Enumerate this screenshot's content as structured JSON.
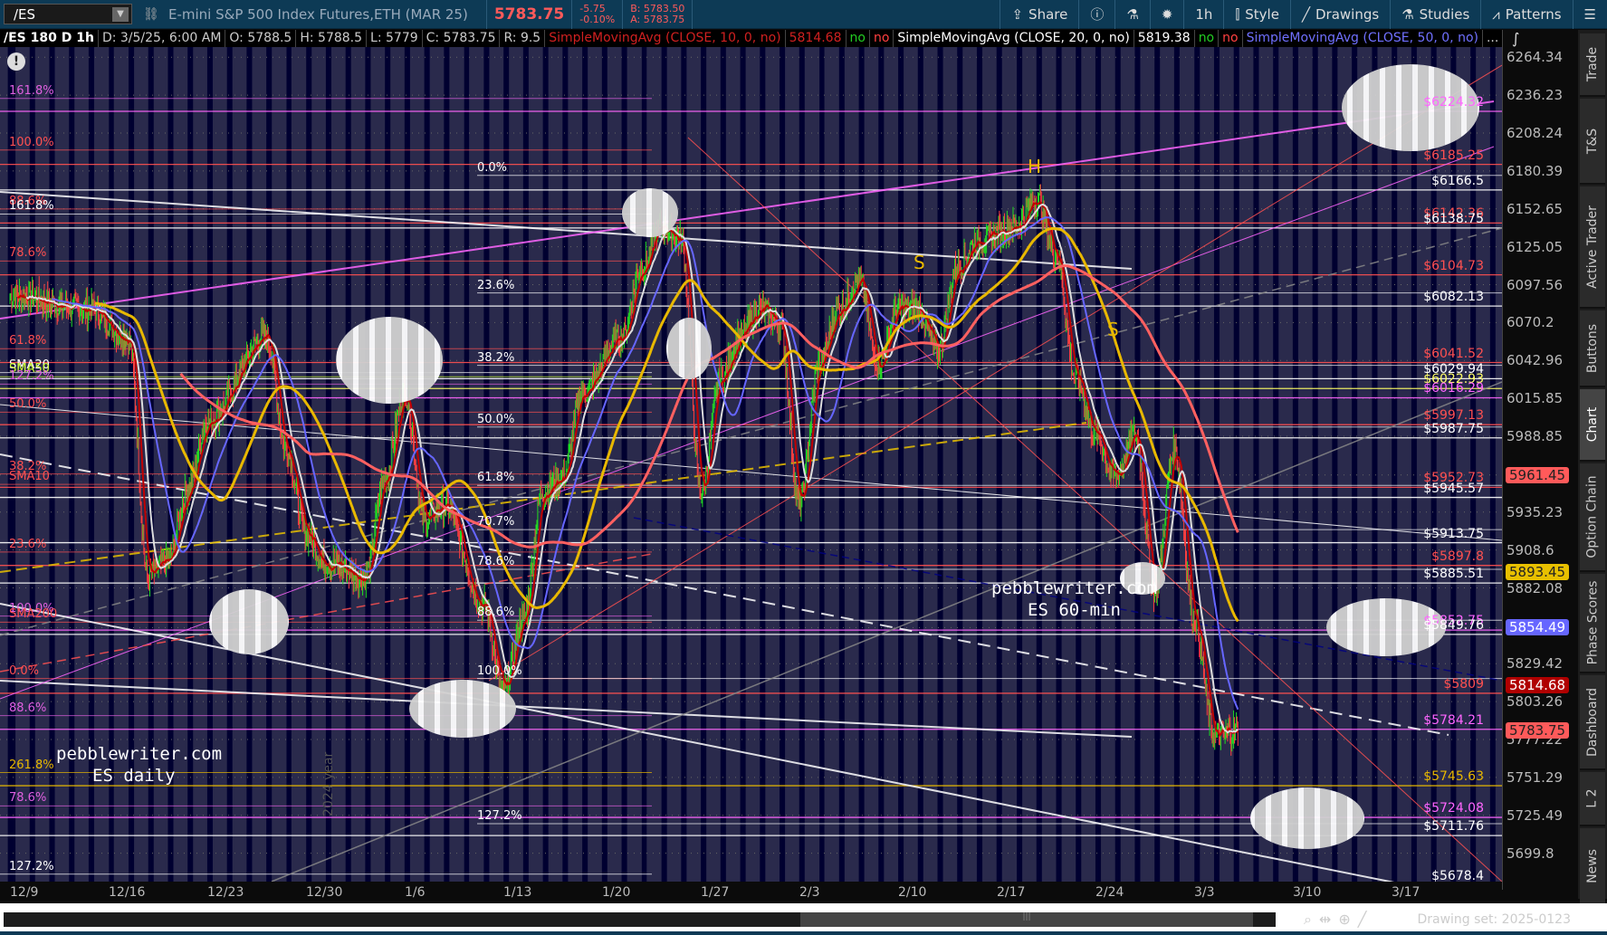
{
  "toolbar": {
    "symbol": "/ES",
    "description": "E-mini S&P 500 Index Futures,ETH (MAR 25)",
    "last": "5783.75",
    "change": "-5.75",
    "change_pct": "-0.10%",
    "bid": "B: 5783.50",
    "ask": "A: 5783.75",
    "share": "Share",
    "timeframe": "1h",
    "style": "Style",
    "drawings": "Drawings",
    "studies": "Studies",
    "patterns": "Patterns"
  },
  "infobar": {
    "symbol": "/ES 180 D 1h",
    "date": "D: 3/5/25, 6:00 AM",
    "open": "O: 5788.5",
    "high": "H: 5788.5",
    "low": "L: 5779",
    "close": "C: 5783.75",
    "range": "R: 9.5",
    "sma10": "SimpleMovingAvg (CLOSE, 10, 0, no)",
    "sma10_val": "5814.68",
    "no1": "no",
    "no2": "no",
    "sma20": "SimpleMovingAvg (CLOSE, 20, 0, no)",
    "sma20_val": "5819.38",
    "no3": "no",
    "no4": "no",
    "sma50": "SimpleMovingAvg (CLOSE, 50, 0, no)",
    "more": "..."
  },
  "price_axis": {
    "ticks": [
      "6264.34",
      "6236.23",
      "6208.24",
      "6180.39",
      "6152.65",
      "6125.05",
      "6097.56",
      "6070.2",
      "6042.96",
      "6015.85",
      "5988.85",
      "5961.45",
      "5935.23",
      "5908.6",
      "5882.08",
      "5854.49",
      "5829.42",
      "5803.26",
      "5777.22",
      "5751.29",
      "5725.49",
      "5699.8"
    ],
    "tags": [
      {
        "value": "5961.45",
        "bg": "#ff5a5a",
        "fg": "#222"
      },
      {
        "value": "5893.45",
        "bg": "#e8c000",
        "fg": "#222"
      },
      {
        "value": "5854.49",
        "bg": "#6666ff",
        "fg": "#fff"
      },
      {
        "value": "5814.68",
        "bg": "#b00000",
        "fg": "#fff"
      },
      {
        "value": "5783.75",
        "bg": "#ff5a5a",
        "fg": "#222"
      }
    ]
  },
  "date_axis": [
    "12/9",
    "12/16",
    "12/23",
    "12/30",
    "1/6",
    "1/13",
    "1/20",
    "1/27",
    "2/3",
    "2/10",
    "2/17",
    "2/24",
    "3/3",
    "3/10",
    "3/17"
  ],
  "right_levels": [
    {
      "label": "$6224.32",
      "price": 6224.32,
      "color": "#ff66ff"
    },
    {
      "label": "$6185.25",
      "price": 6185.25,
      "color": "#ff5050"
    },
    {
      "label": "$6166.5",
      "price": 6166.5,
      "color": "#ffffff"
    },
    {
      "label": "$6142.36",
      "price": 6142.36,
      "color": "#ff5050"
    },
    {
      "label": "$6138.75",
      "price": 6138.75,
      "color": "#ffffff"
    },
    {
      "label": "$6104.73",
      "price": 6104.73,
      "color": "#ff5050"
    },
    {
      "label": "$6082.13",
      "price": 6082.13,
      "color": "#ffffff"
    },
    {
      "label": "$6041.52",
      "price": 6041.52,
      "color": "#ff5050"
    },
    {
      "label": "$6029.94",
      "price": 6029.94,
      "color": "#ffffff"
    },
    {
      "label": "$6022.93",
      "price": 6022.93,
      "color": "#ffff66"
    },
    {
      "label": "$6016.29",
      "price": 6016.29,
      "color": "#ff66ff"
    },
    {
      "label": "$5997.13",
      "price": 5997.13,
      "color": "#ff5050"
    },
    {
      "label": "$5987.75",
      "price": 5987.75,
      "color": "#ffffff"
    },
    {
      "label": "$5952.73",
      "price": 5952.73,
      "color": "#ff5050"
    },
    {
      "label": "$5945.57",
      "price": 5945.57,
      "color": "#ffffff"
    },
    {
      "label": "$5913.75",
      "price": 5913.75,
      "color": "#ffffff"
    },
    {
      "label": "$5897.8",
      "price": 5897.8,
      "color": "#ff5050"
    },
    {
      "label": "$5885.51",
      "price": 5885.51,
      "color": "#ffffff"
    },
    {
      "label": "$5852.75",
      "price": 5852.75,
      "color": "#ff66ff"
    },
    {
      "label": "$5849.76",
      "price": 5849.76,
      "color": "#ffffff"
    },
    {
      "label": "$5809",
      "price": 5809,
      "color": "#ff5050"
    },
    {
      "label": "$5784.21",
      "price": 5784.21,
      "color": "#ff66ff"
    },
    {
      "label": "$5745.63",
      "price": 5745.63,
      "color": "#e8b800"
    },
    {
      "label": "$5724.08",
      "price": 5724.08,
      "color": "#ff66ff"
    },
    {
      "label": "$5711.76",
      "price": 5711.76,
      "color": "#ffffff"
    },
    {
      "label": "$5678.4",
      "price": 5678.4,
      "color": "#ffffff"
    }
  ],
  "left_levels": [
    {
      "label": "161.8%",
      "price": 6233.8,
      "color": "#e060e0"
    },
    {
      "label": "100.0%",
      "price": 6195.8,
      "color": "#ff5050"
    },
    {
      "label": "88.6%",
      "price": 6152.6,
      "color": "#ff5050"
    },
    {
      "label": "161.8%",
      "price": 6148.9,
      "color": "#ffffff"
    },
    {
      "label": "78.6%",
      "price": 6114.7,
      "color": "#ff5050"
    },
    {
      "label": "61.8%",
      "price": 6051.4,
      "color": "#ff5050"
    },
    {
      "label": "SMA20",
      "price": 6034.3,
      "color": "#ffffff"
    },
    {
      "label": "SMA50",
      "price": 6031.3,
      "color": "#ccff33"
    },
    {
      "label": "127.2%",
      "price": 6026.1,
      "color": "#e060e0"
    },
    {
      "label": "50.0%",
      "price": 6006,
      "color": "#ff5050"
    },
    {
      "label": "38.2%",
      "price": 5962.2,
      "color": "#ff5050"
    },
    {
      "label": "SMA10",
      "price": 5954.8,
      "color": "#ff5050"
    },
    {
      "label": "23.6%",
      "price": 5907.2,
      "color": "#ff5050"
    },
    {
      "label": "100.0%",
      "price": 5862.5,
      "color": "#e060e0"
    },
    {
      "label": "SMA200",
      "price": 5858.2,
      "color": "#ff5050"
    },
    {
      "label": "0.0%",
      "price": 5819.2,
      "color": "#ff5050"
    },
    {
      "label": "88.6%",
      "price": 5793.6,
      "color": "#e060e0"
    },
    {
      "label": "261.8%",
      "price": 5754.6,
      "color": "#e8b800"
    },
    {
      "label": "78.6%",
      "price": 5731.9,
      "color": "#e060e0"
    },
    {
      "label": "127.2%",
      "price": 5685.7,
      "color": "#ffffff"
    }
  ],
  "mid_levels": [
    {
      "label": "0.0%",
      "price": 6177.2
    },
    {
      "label": "23.6%",
      "price": 6091.6
    },
    {
      "label": "38.2%",
      "price": 6039.5
    },
    {
      "label": "50.0%",
      "price": 5995.5
    },
    {
      "label": "61.8%",
      "price": 5954.1
    },
    {
      "label": "70.7%",
      "price": 5922.9
    },
    {
      "label": "78.6%",
      "price": 5895.1
    },
    {
      "label": "88.6%",
      "price": 5859.6
    },
    {
      "label": "100.0%",
      "price": 5819.2
    },
    {
      "label": "127.2%",
      "price": 5719.8
    }
  ],
  "watermarks": {
    "daily_site": "pebblewriter.com",
    "daily_tf": "ES daily",
    "hourly_site": "pebblewriter.com",
    "hourly_tf": "ES 60-min",
    "year": "2024 year"
  },
  "patterns": {
    "head": "H",
    "shoulder_left": "S",
    "shoulder_right": "S"
  },
  "side_tabs": [
    "Trade",
    "T&S",
    "Active Trader",
    "Buttons",
    "Chart",
    "Option Chain",
    "Phase Scores",
    "Dashboard",
    "L 2",
    "News"
  ],
  "active_tab": "Chart",
  "footer": {
    "drawing_set": "Drawing set: 2025-0123"
  },
  "chart_data": {
    "type": "candlestick",
    "title": "/ES 180 D 1h",
    "scale": "log",
    "ylim": [
      5680.6,
      6271.9
    ],
    "price_keypoints": [
      [
        0,
        6090
      ],
      [
        4,
        6080
      ],
      [
        6,
        6060
      ],
      [
        7,
        5890
      ],
      [
        8,
        5900
      ],
      [
        9,
        5950
      ],
      [
        10,
        6000
      ],
      [
        13,
        6060
      ],
      [
        14,
        5980
      ],
      [
        15,
        5920
      ],
      [
        16,
        5900
      ],
      [
        18,
        5890
      ],
      [
        19,
        5960
      ],
      [
        20,
        6020
      ],
      [
        21,
        5930
      ],
      [
        22,
        5940
      ],
      [
        24,
        5870
      ],
      [
        25,
        5810
      ],
      [
        26,
        5860
      ],
      [
        27,
        5950
      ],
      [
        28,
        5960
      ],
      [
        29,
        6020
      ],
      [
        31,
        6060
      ],
      [
        32,
        6110
      ],
      [
        33,
        6140
      ],
      [
        34,
        6130
      ],
      [
        35,
        5950
      ],
      [
        36,
        6030
      ],
      [
        37,
        6060
      ],
      [
        38,
        6080
      ],
      [
        39,
        6070
      ],
      [
        40,
        5940
      ],
      [
        41,
        6040
      ],
      [
        42,
        6080
      ],
      [
        43,
        6100
      ],
      [
        44,
        6040
      ],
      [
        45,
        6080
      ],
      [
        46,
        6080
      ],
      [
        47,
        6050
      ],
      [
        48,
        6110
      ],
      [
        49,
        6130
      ],
      [
        51,
        6140
      ],
      [
        52,
        6160
      ],
      [
        53,
        6120
      ],
      [
        54,
        6030
      ],
      [
        55,
        5990
      ],
      [
        56,
        5960
      ],
      [
        57,
        5990
      ],
      [
        58,
        5880
      ],
      [
        59,
        5980
      ],
      [
        60,
        5860
      ],
      [
        61,
        5780
      ],
      [
        62.25,
        5783.75
      ]
    ],
    "studies": [
      {
        "name": "SMA10",
        "period": 10,
        "color": "#c00000"
      },
      {
        "name": "SMA20",
        "period": 20,
        "color": "#dddddd"
      },
      {
        "name": "SMA50",
        "period": 50,
        "color": "#6666ff"
      },
      {
        "name": "SMA100",
        "period": 100,
        "color": "#e8b800"
      },
      {
        "name": "SMA200",
        "period": 200,
        "color": "#ff6060"
      }
    ]
  }
}
